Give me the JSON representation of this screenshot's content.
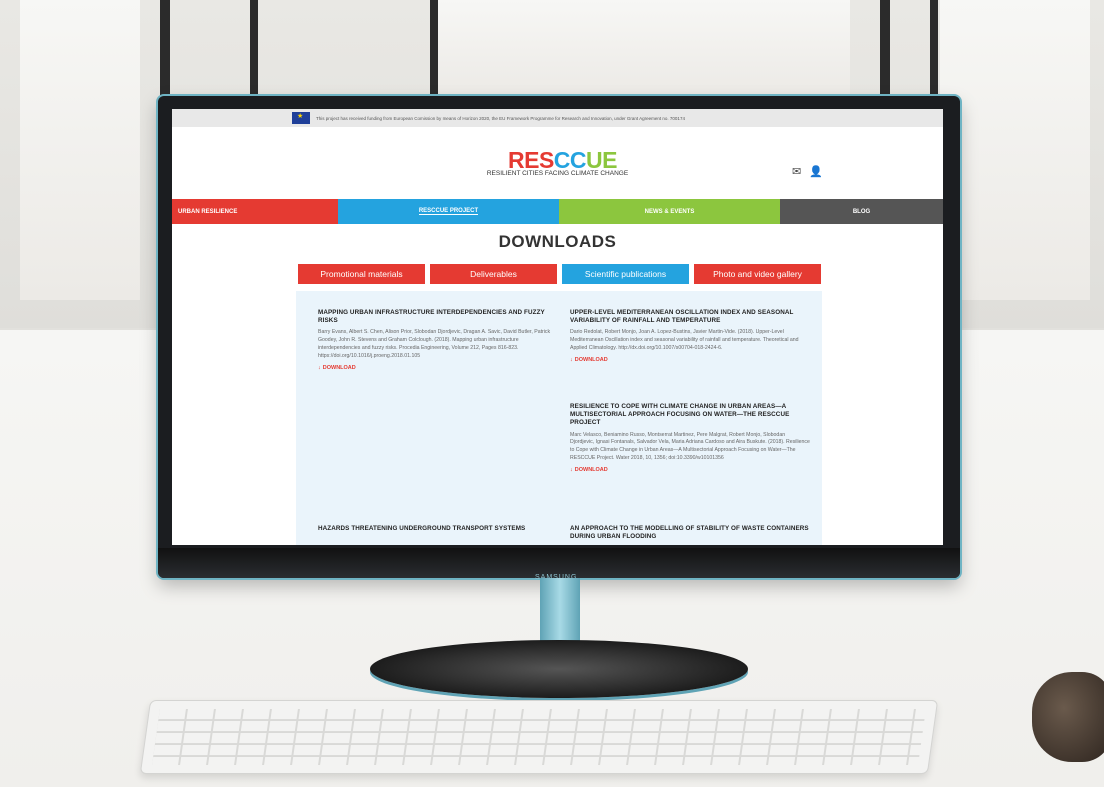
{
  "topbar": {
    "funding_text": "This project has received funding from European Comission by means of Horizon 2020, the EU Framework Programme for Research and Innovation, under Grant Agreement no. 700174"
  },
  "header": {
    "logo_r": "RES",
    "logo_c": "CC",
    "logo_u": "UE",
    "tagline": "RESILIENT CITIES FACING CLIMATE CHANGE",
    "icons": [
      "mail-icon",
      "user-icon"
    ]
  },
  "nav": {
    "urban": "URBAN RESILIENCE",
    "project": "RESCCUE PROJECT",
    "news": "NEWS & EVENTS",
    "blog": "BLOG"
  },
  "page": {
    "title": "DOWNLOADS"
  },
  "tabs": [
    "Promotional materials",
    "Deliverables",
    "Scientific publications",
    "Photo and video gallery"
  ],
  "download_label": "DOWNLOAD",
  "publications": [
    {
      "title": "MAPPING URBAN INFRASTRUCTURE INTERDEPENDENCIES AND FUZZY RISKS",
      "body": "Barry Evans, Albert S. Chen, Alison Prior, Slobodan Djordjevic, Dragan A. Savic, David Butler, Patrick Goodey, John R. Stevens and Graham Colclough. (2018). Mapping urban infrastructure interdependencies and fuzzy risks. Procedia Engineering, Volume 212, Pages 816-823. https://doi.org/10.1016/j.proeng.2018.01.105"
    },
    {
      "title": "UPPER-LEVEL MEDITERRANEAN OSCILLATION INDEX AND SEASONAL VARIABILITY OF RAINFALL AND TEMPERATURE",
      "body": "Dario Redolat, Robert Monjo, Joan A. Lopez-Bustins, Javier Martin-Vide. (2018). Upper-Level Mediterranean Oscillation index and seasonal variability of rainfall and temperature. Theoretical and Applied Climatology. http://dx.doi.org/10.1007/s00704-018-2424-6."
    },
    {
      "title": "RESILIENCE TO COPE WITH CLIMATE CHANGE IN URBAN AREAS—A MULTISECTORIAL APPROACH FOCUSING ON WATER—THE RESCCUE PROJECT",
      "body": "Marc Velasco, Beniamino Russo, Montserrat Martinez, Pere Malgrat, Robert Monjo, Slobodan Djordjevic, Ignasi Fontanals, Salvador Vela, Maria Adriana Cardoso and Aira Buskute. (2018). Resilience to Cope with Climate Change in Urban Areas—A Multisectorial Approach Focusing on Water—The RESCCUE Project. Water 2018, 10, 1356; doi:10.3390/w10101356"
    },
    {
      "title": "HAZARDS THREATENING UNDERGROUND TRANSPORT SYSTEMS",
      "body": ""
    },
    {
      "title": "AN APPROACH TO THE MODELLING OF STABILITY OF WASTE CONTAINERS DURING URBAN FLOODING",
      "body": ""
    }
  ],
  "monitor": {
    "brand": "SAMSUNG"
  }
}
